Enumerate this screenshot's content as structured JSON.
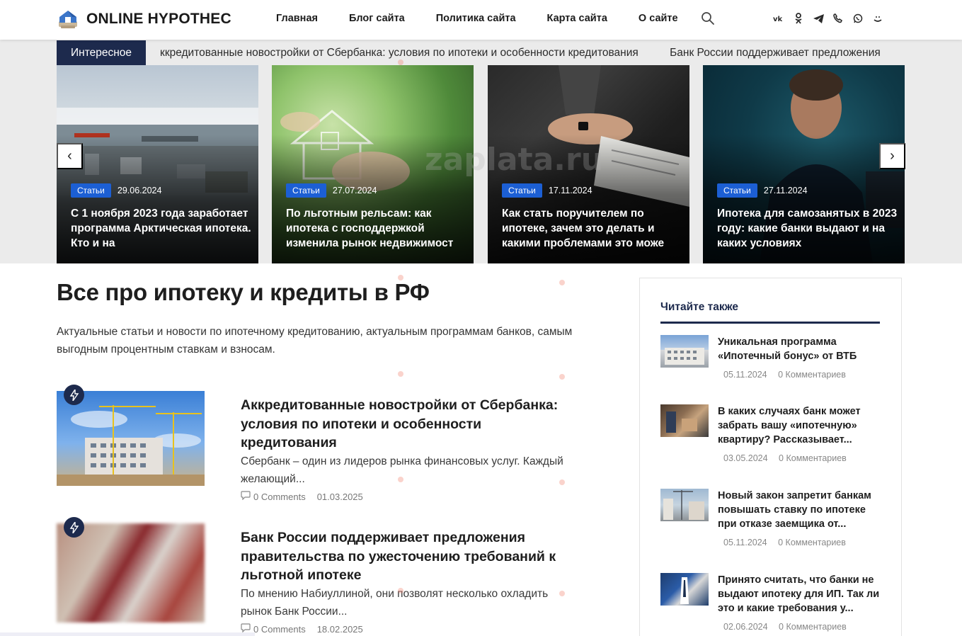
{
  "site": {
    "name": "ONLINE HYPOTHEC"
  },
  "nav": {
    "items": [
      "Главная",
      "Блог сайта",
      "Политика сайта",
      "Карта сайта",
      "О сайте"
    ]
  },
  "socials": [
    "vk-icon",
    "odnoklassniki-icon",
    "telegram-icon",
    "viber-icon",
    "whatsapp-icon",
    "yandex-messenger-icon"
  ],
  "ticker": {
    "label": "Интересное",
    "items": [
      "ккредитованные новостройки от Сбербанка: условия по ипотеки и особенности кредитования",
      "Банк России поддерживает предложения"
    ]
  },
  "slider": {
    "prev_label": "‹",
    "next_label": "›",
    "slides": [
      {
        "category": "Статьи",
        "date": "29.06.2024",
        "title": "С 1 ноября 2023 года заработает программа Арктическая ипотека. Кто и на"
      },
      {
        "category": "Статьи",
        "date": "27.07.2024",
        "title": "По льготным рельсам: как ипотека с господдержкой изменила рынок недвижимост"
      },
      {
        "category": "Статьи",
        "date": "17.11.2024",
        "title": "Как стать поручителем по ипотеке, зачем это делать и какими проблемами это може"
      },
      {
        "category": "Статьи",
        "date": "27.11.2024",
        "title": "Ипотека для самозанятых в 2023 году: какие банки выдают и на каких условиях"
      }
    ]
  },
  "main": {
    "title": "Все про ипотеку и кредиты в РФ",
    "description": "Актуальные статьи и новости по ипотечному кредитованию, актуальным программам банков, самым выгодным процентным ставкам и взносам.",
    "posts": [
      {
        "title": "Аккредитованные новостройки от Сбербанка: условия по ипотеки и особенности кредитования",
        "excerpt": "Сбербанк – один из лидеров рынка финансовых услуг. Каждый желающий...",
        "comments": "0 Comments",
        "date": "01.03.2025"
      },
      {
        "title": "Банк России поддерживает предложения правительства по ужесточению требований к льготной ипотеке",
        "excerpt": "По мнению Набиуллиной, они позволят несколько охладить рынок Банк России...",
        "comments": "0 Comments",
        "date": "18.02.2025"
      }
    ]
  },
  "sidebar": {
    "heading": "Читайте также",
    "items": [
      {
        "title": "Уникальная программа «Ипотечный бонус» от ВТБ",
        "date": "05.11.2024",
        "comments": "0 Комментариев"
      },
      {
        "title": "В каких случаях банк может забрать вашу «ипотечную» квартиру? Рассказывает...",
        "date": "03.05.2024",
        "comments": "0 Комментариев"
      },
      {
        "title": "Новый закон запретит банкам повышать ставку по ипотеке при отказе заемщика от...",
        "date": "05.11.2024",
        "comments": "0 Комментариев"
      },
      {
        "title": "Принято считать, что банки не выдают ипотеку для ИП. Так ли это и какие требования у...",
        "date": "02.06.2024",
        "comments": "0 Комментариев"
      }
    ]
  },
  "watermark": {
    "text": "zaplata.ru"
  },
  "colors": {
    "navy": "#1d2a4d",
    "badge": "#1c5fd4",
    "band": "#ebebeb"
  }
}
